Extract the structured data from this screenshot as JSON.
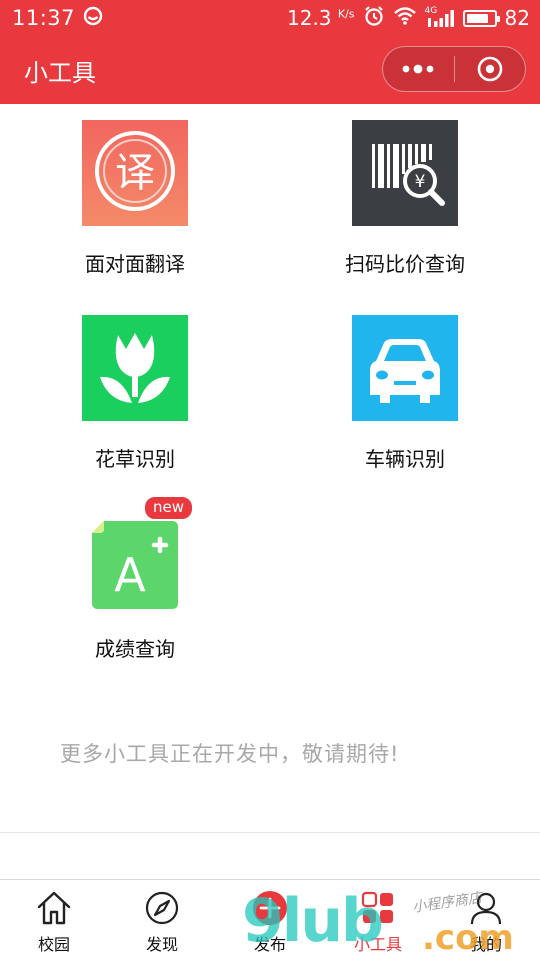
{
  "status_bar": {
    "time": "11:37",
    "speed_value": "12.3",
    "speed_unit": "K/s",
    "network": "4G",
    "battery": "82"
  },
  "nav": {
    "title": "小工具"
  },
  "tools": [
    {
      "label": "面对面翻译",
      "icon": "translate-icon",
      "color": "#f26f60"
    },
    {
      "label": "扫码比价查询",
      "icon": "barcode-price-icon",
      "color": "#3b3e42"
    },
    {
      "label": "花草识别",
      "icon": "flower-icon",
      "color": "#1bcf5f"
    },
    {
      "label": "车辆识别",
      "icon": "car-icon",
      "color": "#21b5ee"
    },
    {
      "label": "成绩查询",
      "icon": "grade-icon",
      "color": "#5cd66b",
      "badge": "new"
    }
  ],
  "icon_glyphs": {
    "translate": "译",
    "yen": "¥",
    "grade": "A"
  },
  "coming_soon": "更多小工具正在开发中，敬请期待!",
  "tabs": [
    {
      "label": "校园",
      "icon": "home-icon"
    },
    {
      "label": "发现",
      "icon": "compass-icon"
    },
    {
      "label": "发布",
      "icon": "plus-icon"
    },
    {
      "label": "小工具",
      "icon": "toolbox-icon",
      "active": true
    },
    {
      "label": "我的",
      "icon": "person-icon"
    }
  ],
  "watermark": {
    "main": "9lub",
    "domain": ".com",
    "small": "小程序商店"
  },
  "colors": {
    "brand": "#e8393f",
    "muted_text": "#a8a8a8"
  }
}
